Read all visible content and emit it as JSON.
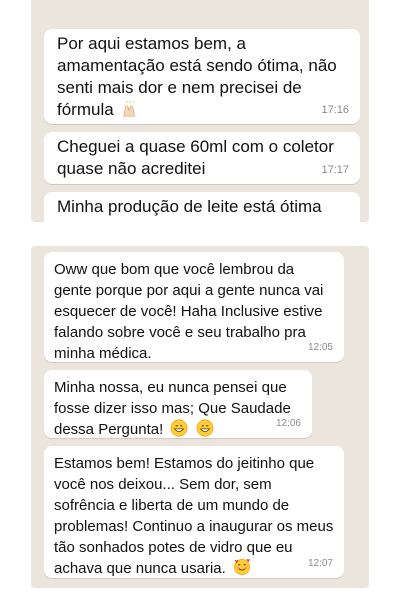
{
  "top_chat": {
    "messages": [
      {
        "text": "Por aqui estamos bem, a amamentação está sendo ótima, não senti mais dor e nem precisei de fórmula",
        "emoji": "raising-hands-icon",
        "time": "17:16"
      },
      {
        "text": "Cheguei a quase 60ml com o coletor quase não acreditei",
        "time": "17:17"
      },
      {
        "text": "Minha produção de leite está ótima"
      }
    ]
  },
  "bottom_chat": {
    "messages": [
      {
        "text": "Oww que bom que você lembrou da gente porque por aqui a gente nunca vai esquecer de você! Haha Inclusive estive falando sobre você e seu trabalho pra minha médica.",
        "time": "12:05"
      },
      {
        "text": "Minha nossa, eu nunca pensei que fosse dizer isso mas; Que Saudade dessa Pergunta!",
        "emoji": "grinning-face-icon x2",
        "time": "12:06"
      },
      {
        "text": "Estamos bem! Estamos do jeitinho que você nos deixou... Sem dor, sem sofrência e liberta de um mundo de problemas! Continuo a inaugurar os meus tão sonhados potes de vidro que eu achava que nunca usaria.",
        "emoji": "smiling-face-with-hearts-icon",
        "time": "12:07"
      }
    ]
  },
  "colors": {
    "chat_background": "#ece5dd",
    "bubble": "#ffffff",
    "timestamp": "#8a8a8a"
  }
}
